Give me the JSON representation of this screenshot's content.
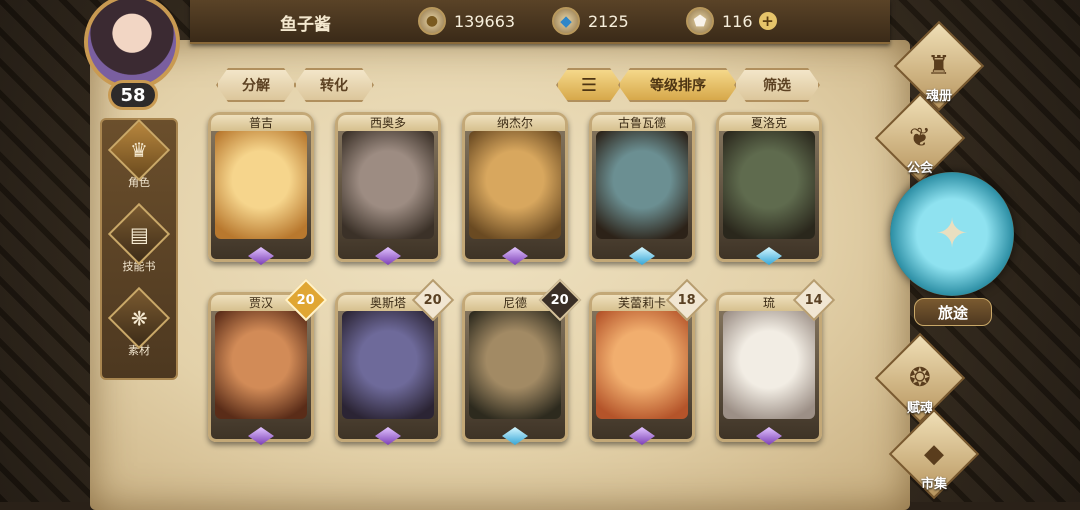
{
  "player": {
    "name": "鱼子酱",
    "level": "58"
  },
  "resources": {
    "gold": {
      "icon": "gold-coin-icon",
      "value": "139663"
    },
    "gems": {
      "icon": "blue-crystal-icon",
      "value": "2125"
    },
    "shards": {
      "icon": "white-crystal-icon",
      "value": "116"
    },
    "plus": "+"
  },
  "sidebar": {
    "items": [
      {
        "label": "角色",
        "icon": "character-icon",
        "glyph": "♛"
      },
      {
        "label": "技能书",
        "icon": "skill-book-icon",
        "glyph": "▤"
      },
      {
        "label": "素材",
        "icon": "material-icon",
        "glyph": "❋"
      }
    ]
  },
  "toolbar": {
    "decompose": "分解",
    "convert": "转化",
    "sort_icon": "sort-lines-icon",
    "sort_label": "等级排序",
    "filter_label": "筛选"
  },
  "heroes": [
    {
      "name": "普吉",
      "gem": "purple",
      "level": "",
      "colors": [
        "#f6d58c",
        "#b8782e"
      ]
    },
    {
      "name": "西奥多",
      "gem": "purple",
      "level": "",
      "colors": [
        "#9d8c82",
        "#3b3128"
      ]
    },
    {
      "name": "纳杰尔",
      "gem": "purple",
      "level": "",
      "colors": [
        "#d8a75e",
        "#6a4a22"
      ]
    },
    {
      "name": "古鲁瓦德",
      "gem": "blue",
      "level": "",
      "colors": [
        "#6b8f92",
        "#2c2218"
      ]
    },
    {
      "name": "夏洛克",
      "gem": "blue",
      "level": "",
      "colors": [
        "#5f6b4e",
        "#2a271c"
      ]
    },
    {
      "name": "贾汉",
      "gem": "purple",
      "level": "20",
      "levelStyle": "gold",
      "colors": [
        "#d28b57",
        "#5a2c18"
      ]
    },
    {
      "name": "奥斯塔",
      "gem": "purple",
      "level": "20",
      "levelStyle": "light",
      "colors": [
        "#6e6a9a",
        "#2b2434"
      ]
    },
    {
      "name": "尼德",
      "gem": "blue",
      "level": "20",
      "levelStyle": "dark",
      "colors": [
        "#a28a64",
        "#2d2a1e"
      ]
    },
    {
      "name": "芙蕾莉卡",
      "gem": "purple",
      "level": "18",
      "levelStyle": "light",
      "colors": [
        "#f1ae6e",
        "#b4542a"
      ]
    },
    {
      "name": "琉",
      "gem": "purple",
      "level": "14",
      "levelStyle": "light",
      "colors": [
        "#f2ede4",
        "#9c8f86"
      ]
    }
  ],
  "rightnav": [
    {
      "label": "魂册",
      "icon": "soul-book-icon",
      "glyph": "♜"
    },
    {
      "label": "公会",
      "icon": "guild-icon",
      "glyph": "❦"
    },
    {
      "label": "赋魂",
      "icon": "soul-infuse-icon",
      "glyph": "❂"
    },
    {
      "label": "市集",
      "icon": "market-icon",
      "glyph": "◆"
    }
  ],
  "journey": {
    "label": "旅途",
    "icon": "journey-emblem-icon",
    "glyph": "✦"
  }
}
